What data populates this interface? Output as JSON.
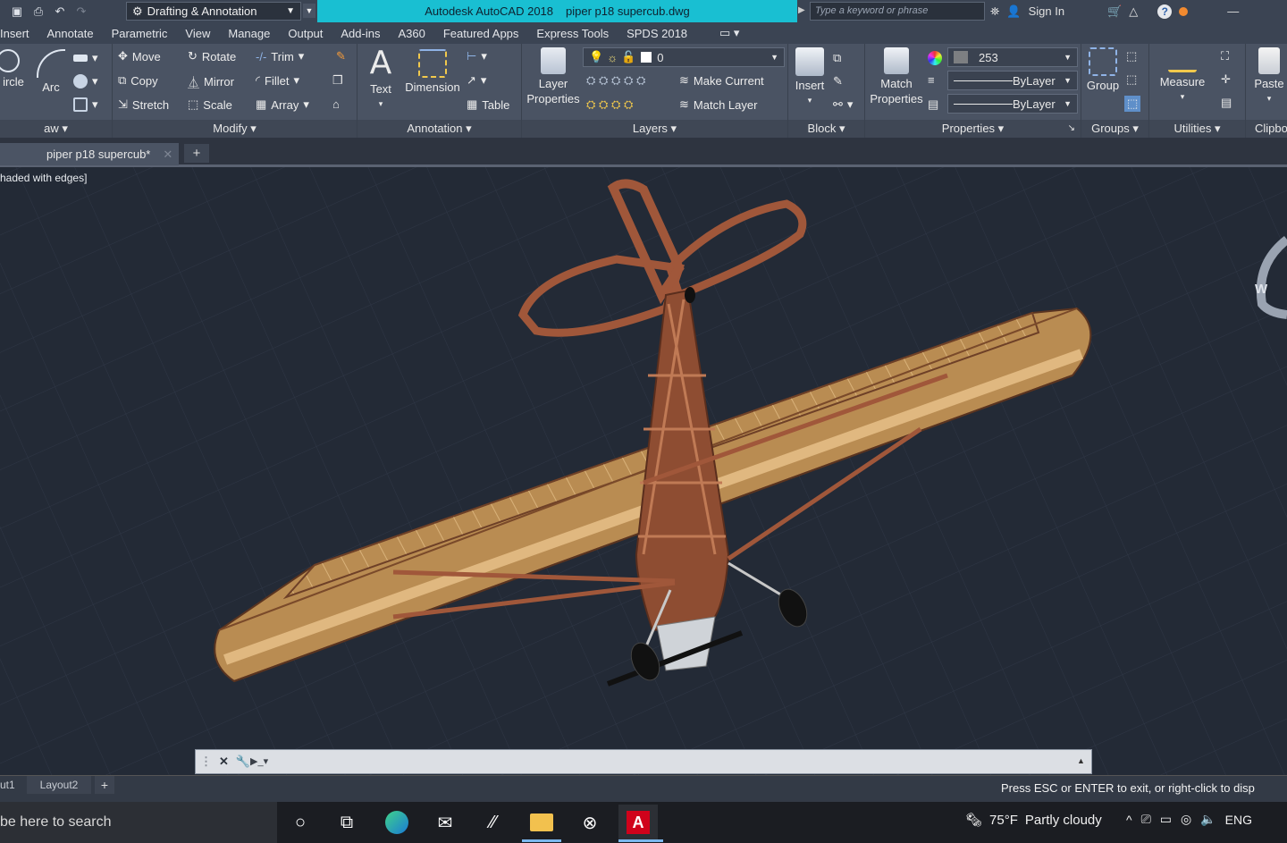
{
  "title_bar": {
    "workspace": "Drafting & Annotation",
    "app_name": "Autodesk AutoCAD 2018",
    "file_name": "piper p18 supercub.dwg",
    "search_placeholder": "Type a keyword or phrase",
    "sign_in": "Sign In"
  },
  "menus": [
    "Insert",
    "Annotate",
    "Parametric",
    "View",
    "Manage",
    "Output",
    "Add-ins",
    "A360",
    "Featured Apps",
    "Express Tools",
    "SPDS 2018"
  ],
  "ribbon": {
    "draw": {
      "circle": "ircle",
      "arc": "Arc",
      "panel": "aw"
    },
    "modify": {
      "move": "Move",
      "rotate": "Rotate",
      "trim": "Trim",
      "copy": "Copy",
      "mirror": "Mirror",
      "fillet": "Fillet",
      "stretch": "Stretch",
      "scale": "Scale",
      "array": "Array",
      "panel": "Modify"
    },
    "annotation": {
      "text": "Text",
      "dimension": "Dimension",
      "table": "Table",
      "panel": "Annotation"
    },
    "layers": {
      "layer_properties_1": "Layer",
      "layer_properties_2": "Properties",
      "layer_value": "0",
      "make_current": "Make Current",
      "match_layer": "Match Layer",
      "panel": "Layers"
    },
    "block": {
      "insert": "Insert",
      "panel": "Block"
    },
    "properties": {
      "match_1": "Match",
      "match_2": "Properties",
      "color_value": "253",
      "linetype": "ByLayer",
      "lineweight": "ByLayer",
      "panel": "Properties"
    },
    "groups": {
      "group": "Group",
      "panel": "Groups"
    },
    "utilities": {
      "measure": "Measure",
      "panel": "Utilities"
    },
    "clipboard": {
      "paste": "Paste",
      "panel": "Clipbo"
    }
  },
  "document_tab": {
    "label": "piper p18 supercub*"
  },
  "viewport": {
    "label": "haded with edges]",
    "compass_letter": "W"
  },
  "layout_tabs": {
    "layout1": "ut1",
    "layout2": "Layout2"
  },
  "status_message": "Press ESC or ENTER to exit, or right-click to disp",
  "taskbar": {
    "search_text": "be here to search",
    "temperature": "75°F",
    "weather": "Partly cloudy",
    "language": "ENG"
  },
  "colors": {
    "accent_title": "#19bfd2",
    "ribbon": "#4a5363",
    "viewport": "#232a36",
    "airframe": "#a0573a",
    "wing_skin": "#c9a06a",
    "autocad_red": "#d0021b"
  }
}
